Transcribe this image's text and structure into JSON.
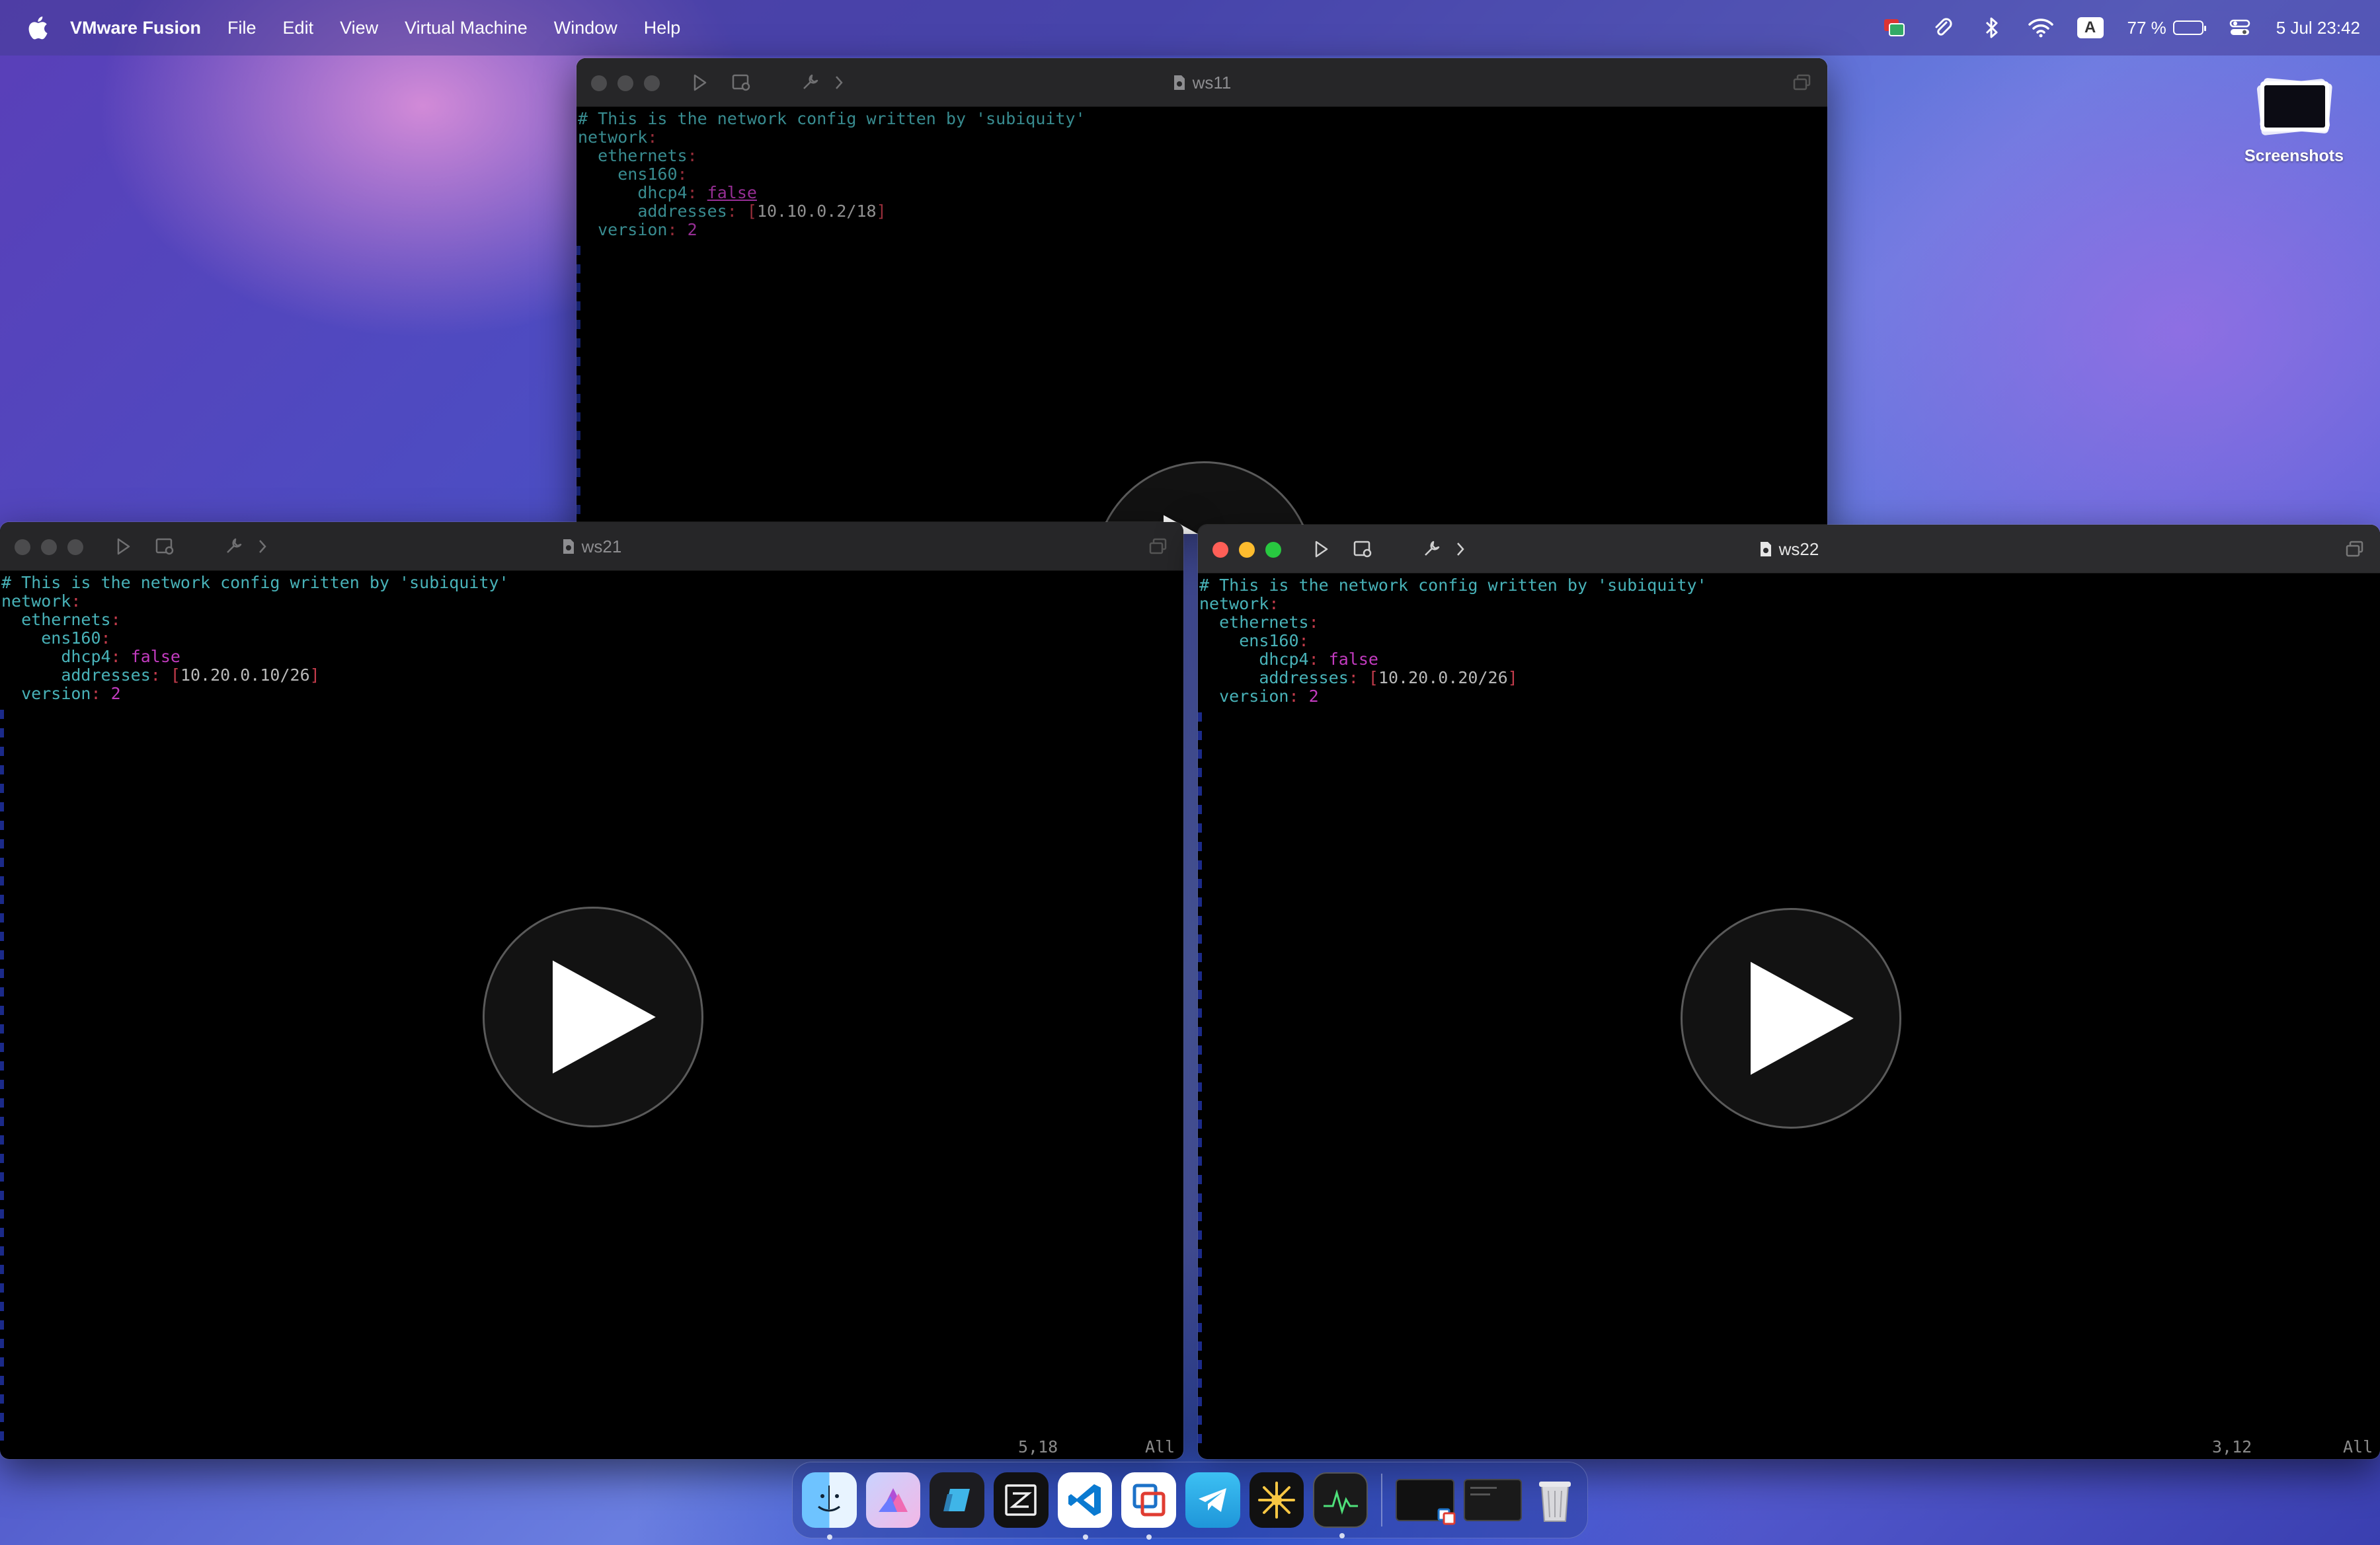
{
  "menubar": {
    "app_name": "VMware Fusion",
    "items": [
      "File",
      "Edit",
      "View",
      "Virtual Machine",
      "Window",
      "Help"
    ],
    "input_source": "A",
    "battery_percent": "77 %",
    "battery_level": 0.77,
    "datetime": "5 Jul  23:42"
  },
  "desktop": {
    "screenshots_label": "Screenshots"
  },
  "windows": {
    "ws11": {
      "title": "ws11",
      "lines": {
        "l1": "# This is the network config written by 'subiquity'",
        "l2_key": "network",
        "l3_key": "ethernets",
        "l4_key": "ens160",
        "l5_key": "dhcp4",
        "l5_val": "false",
        "l6_key": "addresses",
        "l6_val": "10.10.0.2/18",
        "l7_key": "version",
        "l7_val": "2"
      }
    },
    "ws21": {
      "title": "ws21",
      "lines": {
        "l1": "# This is the network config written by 'subiquity'",
        "l2_key": "network",
        "l3_key": "ethernets",
        "l4_key": "ens160",
        "l5_key": "dhcp4",
        "l5_val": "false",
        "l6_key": "addresses",
        "l6_val": "10.20.0.10/26",
        "l7_key": "version",
        "l7_val": "2"
      },
      "cursor_pos": "5,18",
      "scroll_pos": "All"
    },
    "ws22": {
      "title": "ws22",
      "lines": {
        "l1": "# This is the network config written by 'subiquity'",
        "l2_key": "network",
        "l3_key": "ethernets",
        "l4_key": "ens160",
        "l5_key": "dhcp4",
        "l5_val": "false",
        "l6_key": "addresses",
        "l6_val": "10.20.0.20/26",
        "l7_key": "version",
        "l7_val": "2"
      },
      "cursor_pos": "3,12",
      "scroll_pos": "All"
    }
  },
  "dock": {
    "apps": [
      "finder-icon",
      "affinity-icon",
      "files-icon",
      "zed-icon",
      "vscode-icon",
      "vmware-icon",
      "telegram-icon",
      "sparkle-icon",
      "activity-monitor-icon"
    ],
    "minimized": [
      "ws-thumb-1",
      "ws-thumb-2",
      "trash-icon"
    ]
  },
  "colors": {
    "console_key": "#48b2b8",
    "console_value": "#c23bbf",
    "console_punct": "#c23b4b",
    "close": "#ff5f57",
    "minimize": "#febc2e",
    "zoom": "#28c840"
  }
}
